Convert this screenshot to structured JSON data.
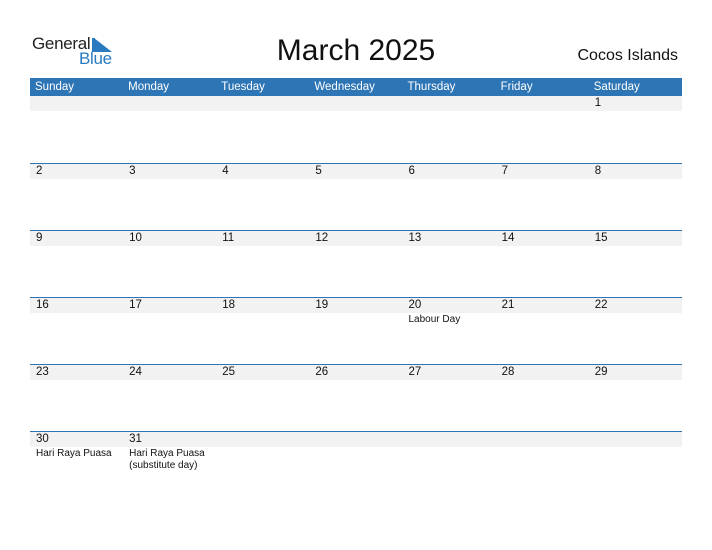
{
  "logo": {
    "general": "General",
    "blue": "Blue"
  },
  "title": "March 2025",
  "country": "Cocos Islands",
  "weekdays": [
    "Sunday",
    "Monday",
    "Tuesday",
    "Wednesday",
    "Thursday",
    "Friday",
    "Saturday"
  ],
  "weeks": [
    [
      {
        "day": ""
      },
      {
        "day": ""
      },
      {
        "day": ""
      },
      {
        "day": ""
      },
      {
        "day": ""
      },
      {
        "day": ""
      },
      {
        "day": "1"
      }
    ],
    [
      {
        "day": "2"
      },
      {
        "day": "3"
      },
      {
        "day": "4"
      },
      {
        "day": "5"
      },
      {
        "day": "6"
      },
      {
        "day": "7"
      },
      {
        "day": "8"
      }
    ],
    [
      {
        "day": "9"
      },
      {
        "day": "10"
      },
      {
        "day": "11"
      },
      {
        "day": "12"
      },
      {
        "day": "13"
      },
      {
        "day": "14"
      },
      {
        "day": "15"
      }
    ],
    [
      {
        "day": "16"
      },
      {
        "day": "17"
      },
      {
        "day": "18"
      },
      {
        "day": "19"
      },
      {
        "day": "20",
        "holiday": "Labour Day"
      },
      {
        "day": "21"
      },
      {
        "day": "22"
      }
    ],
    [
      {
        "day": "23"
      },
      {
        "day": "24"
      },
      {
        "day": "25"
      },
      {
        "day": "26"
      },
      {
        "day": "27"
      },
      {
        "day": "28"
      },
      {
        "day": "29"
      }
    ],
    [
      {
        "day": "30",
        "holiday": "Hari Raya Puasa"
      },
      {
        "day": "31",
        "holiday": "Hari Raya Puasa (substitute day)"
      },
      {
        "day": ""
      },
      {
        "day": ""
      },
      {
        "day": ""
      },
      {
        "day": ""
      },
      {
        "day": ""
      }
    ]
  ],
  "colors": {
    "header": "#2e75b6",
    "band": "#f2f2f2",
    "logo_blue": "#2a7ac0"
  }
}
